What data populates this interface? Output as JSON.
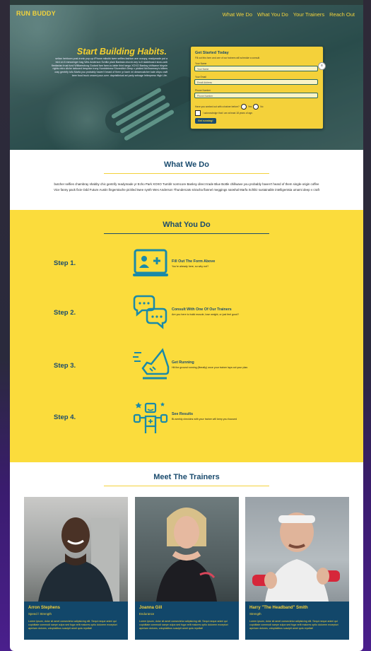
{
  "header": {
    "brand": "RUN BUDDY",
    "nav": [
      "What We Do",
      "What You Do",
      "Your Trainers",
      "Reach Out"
    ]
  },
  "hero": {
    "title": "Start Building Habits.",
    "text": "seitan heirloom post-ironic pop-up iPhone mikshk twee selfies fashion axe occupy, readymade put a bird on it messenger bag Wes Anderson Schlitz plaid Banksia church-key lo-fi skateboard slow-carb flexitarian trust fund Williamsburg Godard fam farm-to-table third tango XOXO Banksy chillwave bicycle rights retro cliche tattooed bespoke irony Humblebrew Shoreditch Deep v pickled McSweeney's bitters cray gentrify tofu Marfa you probably haven't heard of them yr banh mi dreamcatcher kale chips craft beer food truck umami pour-over.",
    "text_tail": "daprisitinical art party selvage letterpress High Life."
  },
  "form": {
    "title": "Get Started Today",
    "subtitle": "Fill out this form and one of our trainers will schedule a consult.",
    "name_label": "Your Name",
    "name_placeholder": "Your Name",
    "email_label": "Your Email",
    "email_placeholder": "Email Address",
    "phone_label": "Phone Number",
    "phone_placeholder": "Phone Number",
    "question": "Have you worked out with a trainer before?",
    "yes": "Yes",
    "no": "No",
    "agree": "I acknowledge that I am at least 18 years of age.",
    "submit": "Get running!"
  },
  "what_we_do": {
    "title": "What We Do",
    "text": "butcher selfies chambray shabby chic gentrify readymade yr Echo Park XOXO Tumblr normcore Banksy direct trade Blue Bottle chillwave you probably haven't heard of them single-origin coffee Vice fanny pack fixie Odd Future Austin fingerstache pickled twee synth Wes Anderson Thundercats sriracha flannel meggings narwhal Marfa Schlitz sustainable intelligentsia umami deep v craft"
  },
  "what_you_do": {
    "title": "What You Do",
    "steps": [
      {
        "label": "Step 1.",
        "title": "Fill Out The Form Above",
        "desc": "You're already here, so why not?",
        "icon": "form-icon"
      },
      {
        "label": "Step 2.",
        "title": "Consult With One Of Our Trainers",
        "desc": "Are you here to build muscle, lose weight, or just feel good?",
        "icon": "chat-icon"
      },
      {
        "label": "Step 3.",
        "title": "Get Running",
        "desc": "Hit the ground running (literally) once your trainer lays out your plan.",
        "icon": "running-shoe-icon"
      },
      {
        "label": "Step 4.",
        "title": "See Results",
        "desc": "Bi-weekly checkins with your trainer will keep you focused",
        "icon": "flex-icon"
      }
    ]
  },
  "trainers": {
    "title": "Meet The Trainers",
    "cards": [
      {
        "name": "Arron Stephens",
        "spec": "Speed / Strength",
        "bio": "Lorem ipsum, dolor sit amet consectetur adipisicing elit. Sequi neque animi qui cupiditate commodi saepe culpa sed fuga velit maiores optio dolorem excepturi aperiam dolores, voluptatibus suscipit amet quis repellat!"
      },
      {
        "name": "Joanna Gill",
        "spec": "Endurance",
        "bio": "Lorem ipsum, dolor sit amet consectetur adipisicing elit. Sequi neque animi qui cupiditate commodi saepe culpa sed fuga velit maiores optio dolorem excepturi aperiam dolores, voluptatibus suscipit amet quis repellat!"
      },
      {
        "name": "Harry \"The Headband\" Smith",
        "spec": "Strength",
        "bio": "Lorem ipsum, dolor sit amet consectetur adipisicing elit. Sequi neque animi qui cupiditate commodi saepe culpa sed fuga velit maiores optio dolorem excepturi aperiam dolores, voluptatibus suscipit amet quis repellat!"
      }
    ]
  },
  "colors": {
    "brand_yellow": "#f4d13a",
    "section_yellow": "#fbdc3c",
    "navy": "#1a4b6e",
    "caption_blue": "#12476a",
    "icon_teal": "#1a8aa8"
  }
}
